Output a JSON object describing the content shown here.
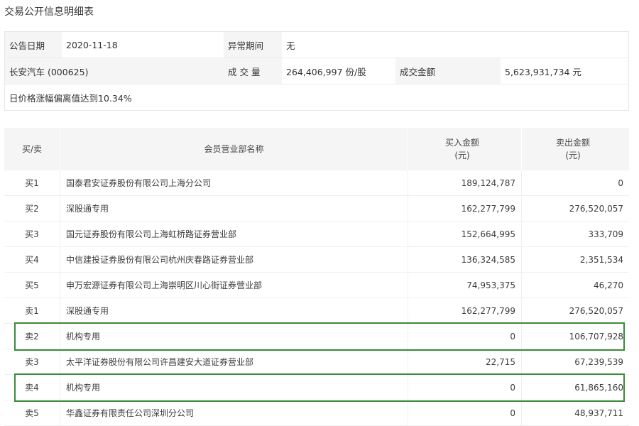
{
  "title": "交易公开信息明细表",
  "info": {
    "date_label": "公告日期",
    "date_value": "2020-11-18",
    "abnormal_label": "异常期间",
    "abnormal_value": "无",
    "stock": "长安汽车 (000625)",
    "volume_label": "成 交 量",
    "volume_value": "264,406,997 份/股",
    "amount_label": "成交金额",
    "amount_value": "5,623,931,734 元",
    "reason": "日价格涨幅偏离值达到10.34%"
  },
  "table": {
    "headers": {
      "side": "买/卖",
      "name": "会员营业部名称",
      "buy_line1": "买入金额",
      "buy_line2": "(元)",
      "sell_line1": "卖出金额",
      "sell_line2": "(元)"
    },
    "rows": [
      {
        "side": "买1",
        "name": "国泰君安证券股份有限公司上海分公司",
        "buy": "189,124,787",
        "sell": "0"
      },
      {
        "side": "买2",
        "name": "深股通专用",
        "buy": "162,277,799",
        "sell": "276,520,057"
      },
      {
        "side": "买3",
        "name": "国元证券股份有限公司上海虹桥路证券营业部",
        "buy": "152,664,995",
        "sell": "333,709"
      },
      {
        "side": "买4",
        "name": "中信建投证券股份有限公司杭州庆春路证券营业部",
        "buy": "136,324,585",
        "sell": "2,351,534"
      },
      {
        "side": "买5",
        "name": "申万宏源证券有限公司上海崇明区川心街证券营业部",
        "buy": "74,953,375",
        "sell": "46,270"
      },
      {
        "side": "卖1",
        "name": "深股通专用",
        "buy": "162,277,799",
        "sell": "276,520,057"
      },
      {
        "side": "卖2",
        "name": "机构专用",
        "buy": "0",
        "sell": "106,707,928"
      },
      {
        "side": "卖3",
        "name": "太平洋证券股份有限公司许昌建安大道证券营业部",
        "buy": "22,715",
        "sell": "67,239,539"
      },
      {
        "side": "卖4",
        "name": "机构专用",
        "buy": "0",
        "sell": "61,865,160"
      },
      {
        "side": "卖5",
        "name": "华鑫证券有限责任公司深圳分公司",
        "buy": "0",
        "sell": "48,937,711"
      }
    ]
  },
  "highlight_color": "#3c8a3c"
}
